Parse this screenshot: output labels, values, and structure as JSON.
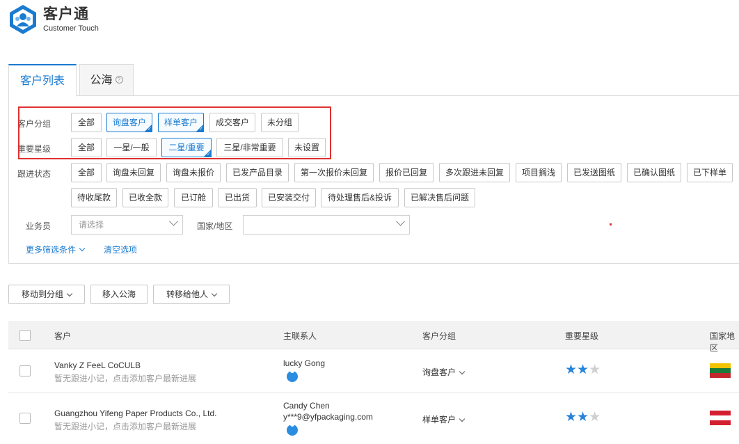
{
  "brand": {
    "title": "客户通",
    "subtitle": "Customer Touch",
    "colors": {
      "accent": "#1a7bd0",
      "highlight": "#e03030"
    }
  },
  "tabs": [
    {
      "label": "客户列表",
      "active": true
    },
    {
      "label": "公海",
      "icon": "question-circle-icon"
    }
  ],
  "filters": {
    "customer_group": {
      "label": "客户分组",
      "options": [
        "全部",
        "询盘客户",
        "样单客户",
        "成交客户",
        "未分组"
      ],
      "selected": [
        "询盘客户",
        "样单客户"
      ]
    },
    "importance": {
      "label": "重要星级",
      "options": [
        "全部",
        "一星/一般",
        "二星/重要",
        "三星/非常重要",
        "未设置"
      ],
      "selected": [
        "二星/重要"
      ]
    },
    "follow_status": {
      "label": "跟进状态",
      "options_row1": [
        "全部",
        "询盘未回复",
        "询盘未报价",
        "已发产品目录",
        "第一次报价未回复",
        "报价已回复",
        "多次跟进未回复",
        "项目搁浅",
        "已发送图纸",
        "已确认图纸",
        "已下样单"
      ],
      "options_row2": [
        "待收尾款",
        "已收全款",
        "已订舱",
        "已出货",
        "已安装交付",
        "待处理售后&投诉",
        "已解决售后问题"
      ]
    },
    "salesperson": {
      "label": "业务员",
      "placeholder": "请选择"
    },
    "country": {
      "label": "国家/地区",
      "placeholder": ""
    },
    "more_filters": "更多筛选条件",
    "clear": "清空选项"
  },
  "actions": {
    "move_group": "移动到分组",
    "move_sea": "移入公海",
    "transfer": "转移给他人"
  },
  "table": {
    "headers": {
      "customer": "客户",
      "contact": "主联系人",
      "group": "客户分组",
      "stars": "重要星级",
      "country": "国家地区"
    },
    "rows": [
      {
        "name": "Vanky Z FeeL CoCULB",
        "note": "暂无跟进小记，点击添加客户最新进展",
        "contact_name": "lucky Gong",
        "contact_email": "",
        "group": "询盘客户",
        "stars": 2,
        "flag": "lithuania-flag"
      },
      {
        "name": "Guangzhou Yifeng Paper Products Co., Ltd.",
        "note": "暂无跟进小记，点击添加客户最新进展",
        "contact_name": "Candy Chen",
        "contact_email": "y***9@yfpackaging.com",
        "group": "样单客户",
        "stars": 2,
        "flag": "austria-flag"
      }
    ]
  }
}
